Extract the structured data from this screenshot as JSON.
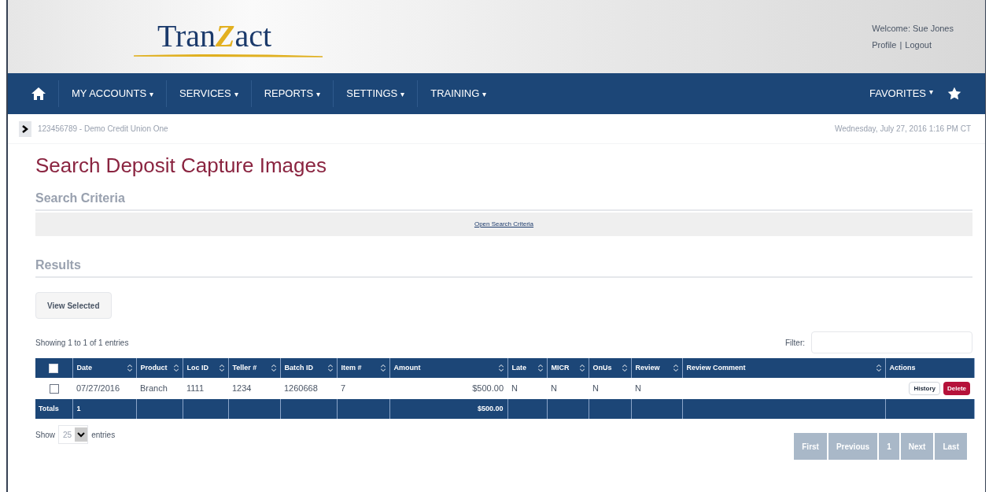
{
  "header": {
    "logo": {
      "prefix": "Tran",
      "mark": "Z",
      "suffix": "act"
    },
    "welcome": "Welcome: Sue Jones",
    "profile_link": "Profile",
    "separator": "|",
    "logout_link": "Logout"
  },
  "nav": {
    "items": [
      {
        "label": "MY ACCOUNTS",
        "caret": "▾"
      },
      {
        "label": "SERVICES",
        "caret": "▾"
      },
      {
        "label": "REPORTS",
        "caret": "▾"
      },
      {
        "label": "SETTINGS",
        "caret": "▾"
      },
      {
        "label": "TRAINING",
        "caret": "▾"
      }
    ],
    "favorites": {
      "label": "FAVORITES",
      "caret": "▾"
    }
  },
  "breadcrumb": {
    "account": "123456789 - Demo Credit Union One",
    "datetime": "Wednesday, July 27, 2016 1:16 PM CT"
  },
  "page_title": "Search Deposit Capture Images",
  "search_criteria": {
    "heading": "Search Criteria",
    "link": "Open Search Criteria"
  },
  "results": {
    "heading": "Results",
    "view_selected": "View Selected",
    "showing": "Showing 1 to 1 of 1 entries",
    "filter_label": "Filter:",
    "table": {
      "select_all_checked": false,
      "columns": [
        {
          "label": "Date",
          "sortable": true
        },
        {
          "label": "Product",
          "sortable": true
        },
        {
          "label": "Loc ID",
          "sortable": true
        },
        {
          "label": "Teller #",
          "sortable": true
        },
        {
          "label": "Batch ID",
          "sortable": true
        },
        {
          "label": "Item #",
          "sortable": true
        },
        {
          "label": "Amount",
          "sortable": true,
          "kind": "amount"
        },
        {
          "label": "Late",
          "sortable": true
        },
        {
          "label": "MICR",
          "sortable": true
        },
        {
          "label": "OnUs",
          "sortable": true
        },
        {
          "label": "Review",
          "sortable": true
        },
        {
          "label": "Review Comment",
          "sortable": true
        },
        {
          "label": "Actions",
          "sortable": false
        }
      ],
      "rows": [
        {
          "checked": false,
          "cells": [
            "07/27/2016",
            "Branch",
            "1111",
            "1234",
            "1260668",
            "7",
            "$500.00",
            "N",
            "N",
            "N",
            "N",
            ""
          ],
          "actions": [
            {
              "label": "History",
              "kind": "default"
            },
            {
              "label": "Delete",
              "kind": "danger"
            }
          ]
        }
      ],
      "totals": {
        "label": "Totals",
        "cells": [
          "1",
          "",
          "",
          "",
          "",
          "",
          "$500.00",
          "",
          "",
          "",
          "",
          "",
          ""
        ]
      }
    },
    "show_prefix": "Show",
    "page_size": "25",
    "show_suffix": "entries",
    "pagination": [
      {
        "label": "First",
        "disabled": true
      },
      {
        "label": "Previous",
        "disabled": true
      },
      {
        "label": "1",
        "disabled": true
      },
      {
        "label": "Next",
        "disabled": true
      },
      {
        "label": "Last",
        "disabled": true
      }
    ]
  }
}
